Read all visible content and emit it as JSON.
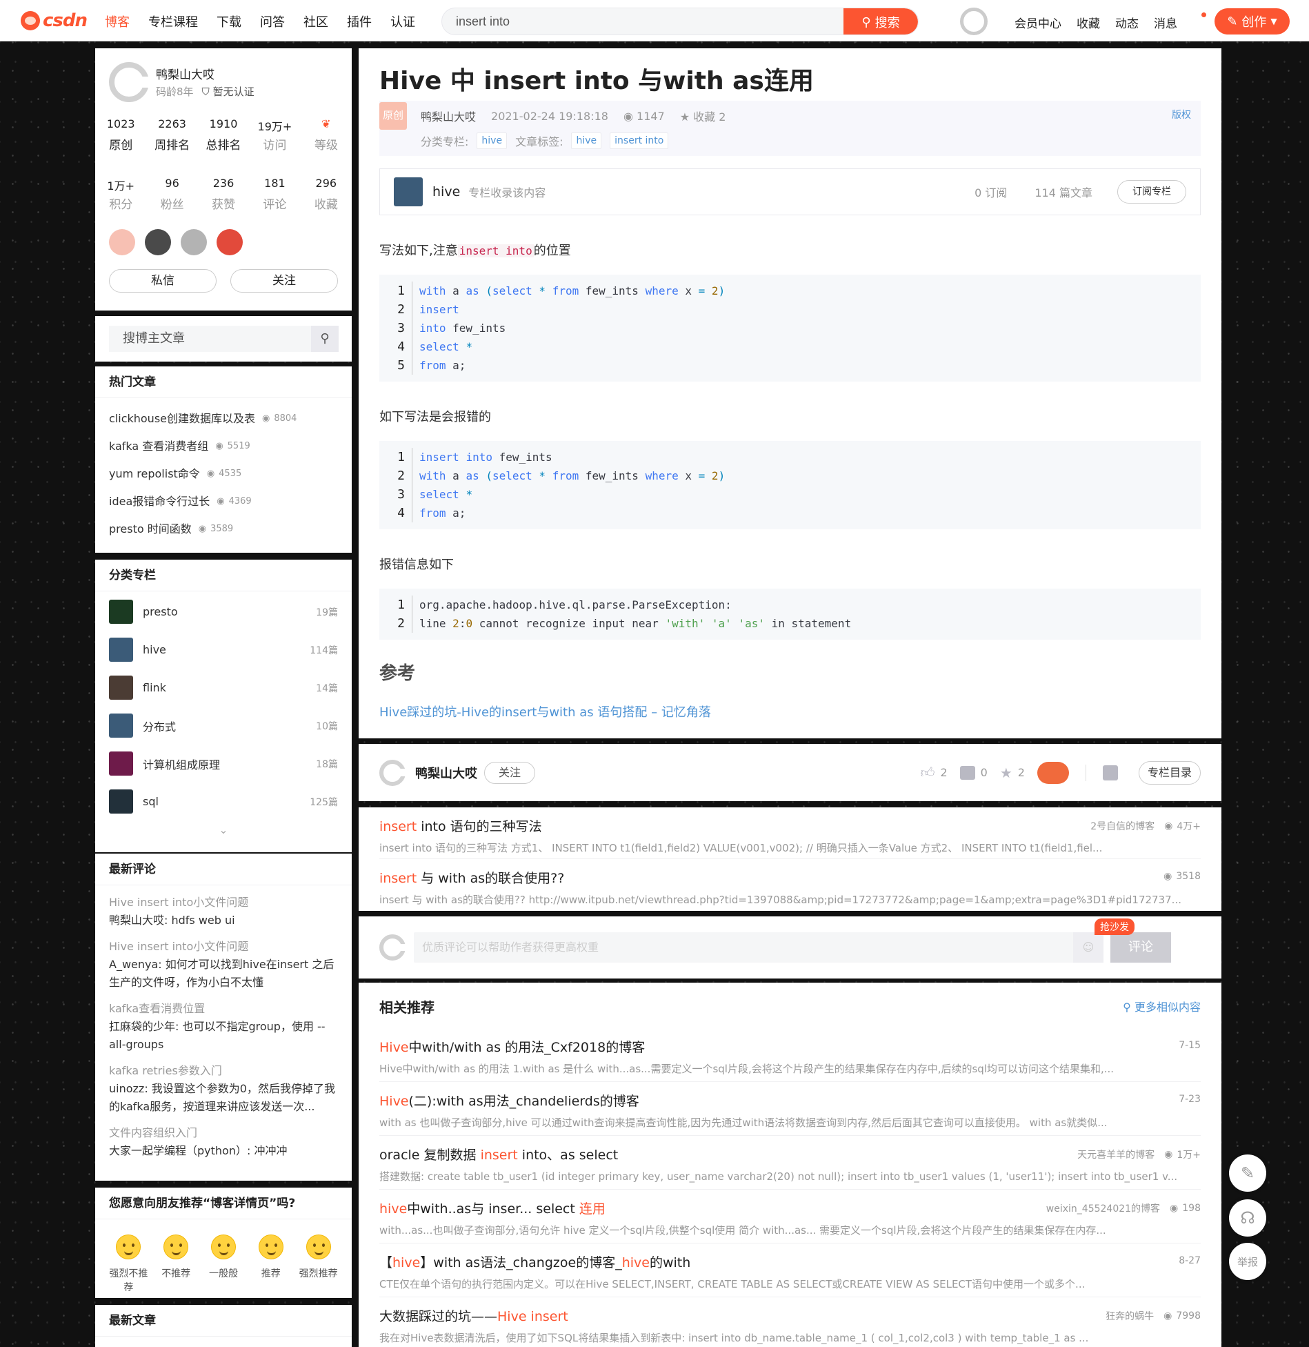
{
  "topbar": {
    "logo_text": "csdn",
    "nav": [
      "博客",
      "专栏课程",
      "下载",
      "问答",
      "社区",
      "插件",
      "认证"
    ],
    "search_value": "insert into",
    "search_button": "搜索",
    "right": [
      "会员中心",
      "收藏",
      "动态",
      "消息"
    ],
    "create_button": "创作",
    "accent_color": "#fc5531"
  },
  "profile": {
    "name": "鸭梨山大哎",
    "code_age": "码龄8年",
    "cert": "暂无认证",
    "stats1": [
      {
        "n": "1023",
        "l": "原创"
      },
      {
        "n": "2263",
        "l": "周排名"
      },
      {
        "n": "1910",
        "l": "总排名"
      },
      {
        "n": "19万+",
        "l": "访问"
      },
      {
        "n": "",
        "l": "等级"
      }
    ],
    "stats2": [
      {
        "n": "1万+",
        "l": "积分"
      },
      {
        "n": "96",
        "l": "粉丝"
      },
      {
        "n": "236",
        "l": "获赞"
      },
      {
        "n": "181",
        "l": "评论"
      },
      {
        "n": "296",
        "l": "收藏"
      }
    ],
    "message_button": "私信",
    "follow_button": "关注"
  },
  "search_blog": {
    "placeholder": "搜博主文章"
  },
  "hot": {
    "title": "热门文章",
    "items": [
      {
        "t": "clickhouse创建数据库以及表",
        "v": "8804"
      },
      {
        "t": "kafka 查看消费者组",
        "v": "5519"
      },
      {
        "t": "yum repolist命令",
        "v": "4535"
      },
      {
        "t": "idea报错命令行过长",
        "v": "4369"
      },
      {
        "t": "presto 时间函数",
        "v": "3589"
      }
    ]
  },
  "columns": {
    "title": "分类专栏",
    "items": [
      {
        "t": "presto",
        "c": "19篇"
      },
      {
        "t": "hive",
        "c": "114篇"
      },
      {
        "t": "flink",
        "c": "14篇"
      },
      {
        "t": "分布式",
        "c": "10篇"
      },
      {
        "t": "计算机组成原理",
        "c": "18篇"
      },
      {
        "t": "sql",
        "c": "125篇"
      }
    ]
  },
  "comments": {
    "title": "最新评论",
    "items": [
      {
        "t": "Hive insert into小文件问题",
        "c": "鸭梨山大哎: hdfs web ui"
      },
      {
        "t": "Hive insert into小文件问题",
        "c": "A_wenya: 如何才可以找到hive在insert 之后生产的文件呀，作为小白不太懂"
      },
      {
        "t": "kafka查看消费位置",
        "c": "扛麻袋的少年: 也可以不指定group，使用 --all-groups"
      },
      {
        "t": "kafka retries参数入门",
        "c": "uinozz: 我设置这个参数为0，然后我停掉了我的kafka服务，按道理来讲应该发送一次..."
      },
      {
        "t": "文件内容组织入门",
        "c": "大家一起学编程（python）: 冲冲冲"
      }
    ]
  },
  "vote": {
    "title": "您愿意向朋友推荐“博客详情页”吗?",
    "options": [
      "强烈不推荐",
      "不推荐",
      "一般般",
      "推荐",
      "强烈推荐"
    ]
  },
  "latest": {
    "title": "最新文章"
  },
  "article": {
    "title": "Hive 中 insert into 与with as连用",
    "original": "原创",
    "author": "鸭梨山大哎",
    "date": "2021-02-24 19:18:18",
    "views": "1147",
    "fav": "收藏 2",
    "copyright": "版权",
    "category_label": "分类专栏:",
    "category": "hive",
    "tags_label": "文章标签:",
    "tags": [
      "hive",
      "insert into"
    ],
    "column_name": "hive",
    "column_desc": "专栏收录该内容",
    "column_subs": "0 订阅",
    "column_articles": "114 篇文章",
    "column_subscribe": "订阅专栏",
    "p1_pre": "写法如下,注意",
    "p1_code": "insert into",
    "p1_post": "的位置",
    "code1": [
      "with a as (select * from few_ints where x = 2)",
      "insert",
      "into few_ints",
      "select *",
      "from a;"
    ],
    "p2": "如下写法是会报错的",
    "code2": [
      "insert into few_ints",
      "with a as (select * from few_ints where x = 2)",
      "select *",
      "from a;"
    ],
    "p3": "报错信息如下",
    "code3": [
      "org.apache.hadoop.hive.ql.parse.ParseException:",
      "line 2:0 cannot recognize input near 'with' 'a' 'as' in statement"
    ],
    "ref_title": "参考",
    "ref_link": "Hive踩过的坑-Hive的insert与with as 语句搭配 – 记忆角落"
  },
  "toolbar": {
    "author": "鸭梨山大哎",
    "follow": "关注",
    "likes": "2",
    "comments": "0",
    "favs": "2",
    "catalog": "专栏目录"
  },
  "rec_top": [
    {
      "t": "insert into 语句的三种写法",
      "who": "2号自信的博客",
      "v": "4万+",
      "d": "insert into 语句的三种写法 方式1、 INSERT INTO t1(field1,field2) VALUE(v001,v002);            // 明确只插入一条Value 方式2、 INSERT INTO t1(field1,fiel..."
    },
    {
      "t": "insert 与 with as的联合使用??",
      "who": "",
      "v": "3518",
      "d": "insert 与 with as的联合使用??    http://www.itpub.net/viewthread.php?tid=1397088&amp;pid=17273772&amp;page=1&amp;extra=page%3D1#pid172737..."
    }
  ],
  "comment_box": {
    "placeholder": "优质评论可以帮助作者获得更高权重",
    "sofa": "抢沙发",
    "submit": "评论"
  },
  "related": {
    "title": "相关推荐",
    "more": "更多相似内容",
    "items": [
      {
        "t": "Hive中with/with as 的用法_Cxf2018的博客",
        "who": "",
        "v": "",
        "date": "7-15",
        "d": "Hive中with/with as 的用法 1.with as 是什么 with...as...需要定义一个sql片段,会将这个片段产生的结果集保存在内存中,后续的sql均可以访问这个结果集和,..."
      },
      {
        "t": "Hive(二):with as用法_chandelierds的博客",
        "who": "",
        "v": "",
        "date": "7-23",
        "d": "with as 也叫做子查询部分,hive 可以通过with查询来提高查询性能,因为先通过with语法将数据查询到内存,然后后面其它查询可以直接使用。 with as就类似..."
      },
      {
        "t": "oracle 复制数据 insert into、as select",
        "who": "天元喜羊羊的博客",
        "v": "1万+",
        "date": "",
        "d": "搭建数据:   create table tb_user1 (id integer primary key, user_name varchar2(20) not null); insert into tb_user1 values (1, 'user11'); insert into tb_user1 v..."
      },
      {
        "t": "hive中with..as与 inser... select 连用",
        "who": "weixin_45524021的博客",
        "v": "198",
        "date": "",
        "d": "with...as...也叫做子查询部分,语句允许 hive 定义一个sql片段,供整个sql使用 简介 with...as... 需要定义一个sql片段,会将这个片段产生的结果集保存在内存..."
      },
      {
        "t": "【hive】with as语法_changzoe的博客_hive的with",
        "who": "",
        "v": "",
        "date": "8-27",
        "d": "CTE仅在单个语句的执行范围内定义。可以在Hive SELECT,INSERT, CREATE TABLE AS SELECT或CREATE VIEW AS SELECT语句中使用一个或多个..."
      },
      {
        "t": "大数据踩过的坑——Hive insert",
        "who": "狂奔的蜗牛",
        "v": "7998",
        "date": "",
        "d": "我在对Hive表数据清洗后，使用了如下SQL将结果集插入到新表中:    insert into db_name.table_name_1 (     col_1,col2,col3    )   with temp_table_1 as ..."
      }
    ]
  },
  "side_buttons": [
    "举报"
  ]
}
